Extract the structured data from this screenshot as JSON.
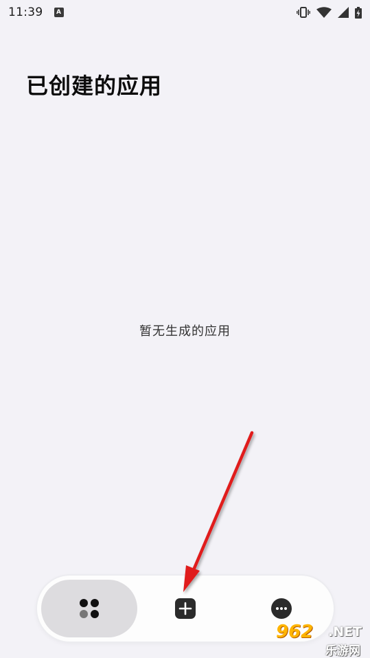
{
  "status_bar": {
    "time": "11:39",
    "app_badge": "A",
    "icons": [
      "vibrate-icon",
      "wifi-icon",
      "signal-icon",
      "battery-icon"
    ]
  },
  "page": {
    "title": "已创建的应用",
    "empty_message": "暂无生成的应用"
  },
  "bottom_nav": {
    "items": [
      {
        "icon": "apps-grid-icon",
        "active": true
      },
      {
        "icon": "add-square-icon",
        "active": false
      },
      {
        "icon": "more-dots-icon",
        "active": false
      }
    ]
  },
  "watermark": {
    "number": "962",
    "suffix": ".NET",
    "site": "乐游网"
  },
  "colors": {
    "background": "#f3f2f7",
    "nav_active": "#dddcdf",
    "arrow": "#e01b1b"
  }
}
